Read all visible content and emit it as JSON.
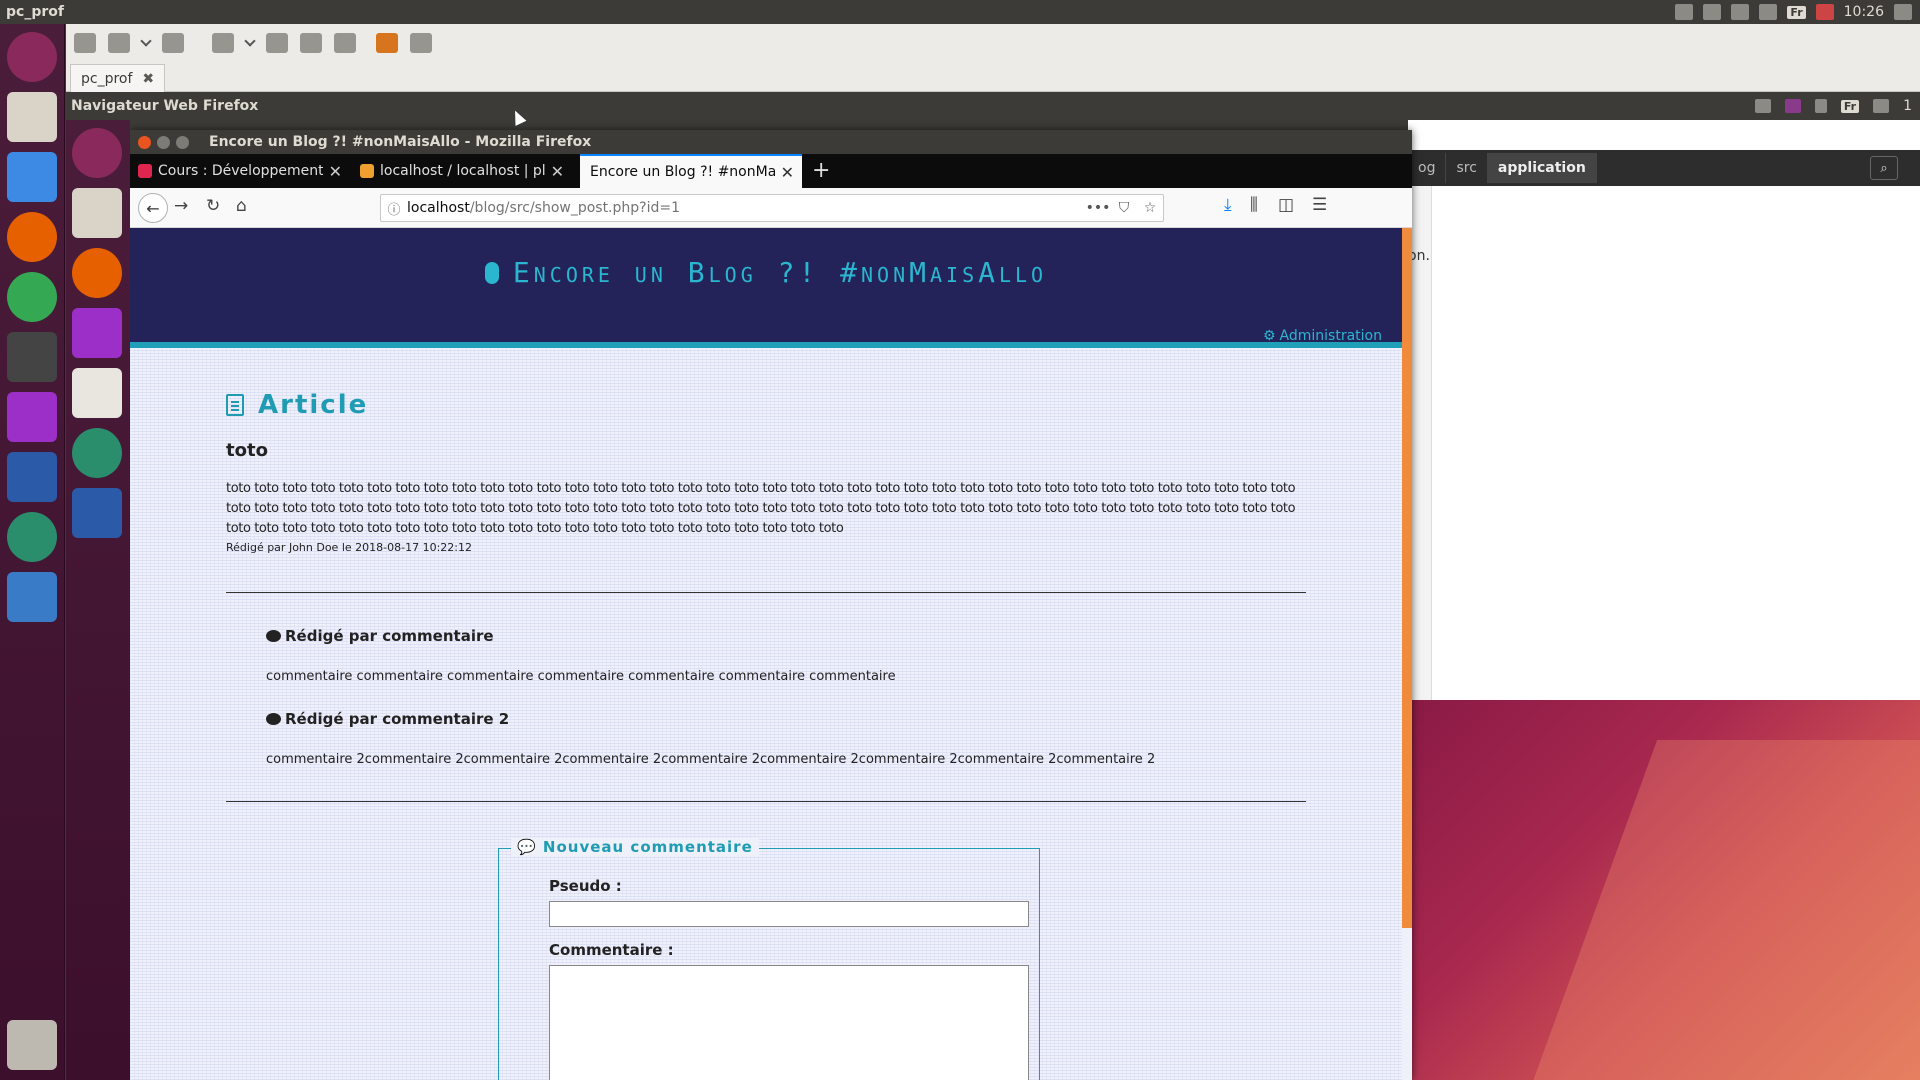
{
  "host": {
    "title": "pc_prof",
    "clock": "10:26",
    "lang": "Fr"
  },
  "remmina": {
    "tab_label": "pc_prof",
    "remote_app_title": "Navigateur Web Firefox",
    "remote_lang": "Fr",
    "remote_clock": "1"
  },
  "background_window": {
    "breadcrumbs": [
      "og",
      "src",
      "application"
    ],
    "partial_text": "on."
  },
  "firefox": {
    "window_title": "Encore un Blog ?! #nonMaisAllo - Mozilla Firefox",
    "tabs": [
      {
        "label": "Cours : Développement",
        "favicon_color": "#e0264f"
      },
      {
        "label": "localhost / localhost | pl",
        "favicon_color": "#f0a030"
      },
      {
        "label": "Encore un Blog ?! #nonMai",
        "favicon_color": "",
        "active": true
      }
    ],
    "url_host": "localhost",
    "url_path": "/blog/src/show_post.php?id=1"
  },
  "page": {
    "brand": "Encore un Blog ?! #nonMaisAllo",
    "admin_link": "Administration",
    "section_title": "Article",
    "post": {
      "title": "toto",
      "body": "toto toto toto toto toto toto toto toto toto toto toto toto toto toto toto toto toto toto toto toto toto toto toto toto toto toto toto toto toto toto toto toto toto toto toto toto toto toto toto toto toto toto toto toto toto toto toto toto toto toto toto toto toto toto toto toto toto toto toto toto toto toto toto toto toto toto toto toto toto toto toto toto toto toto toto toto toto toto toto toto toto toto toto toto toto toto toto toto toto toto toto toto toto toto toto toto toto toto",
      "meta": "Rédigé par John Doe le 2018-08-17 10:22:12"
    },
    "comments": [
      {
        "author": "Rédigé par commentaire",
        "text": "commentaire commentaire commentaire commentaire commentaire commentaire commentaire"
      },
      {
        "author": "Rédigé par commentaire 2",
        "text": "commentaire 2commentaire 2commentaire 2commentaire 2commentaire 2commentaire 2commentaire 2commentaire 2commentaire 2"
      }
    ],
    "form": {
      "legend": "Nouveau commentaire",
      "pseudo_label": "Pseudo :",
      "comment_label": "Commentaire :"
    }
  },
  "colors": {
    "header_bg": "#23235a",
    "accent": "#1f9cb3",
    "launcher": "#4a1d3a"
  }
}
